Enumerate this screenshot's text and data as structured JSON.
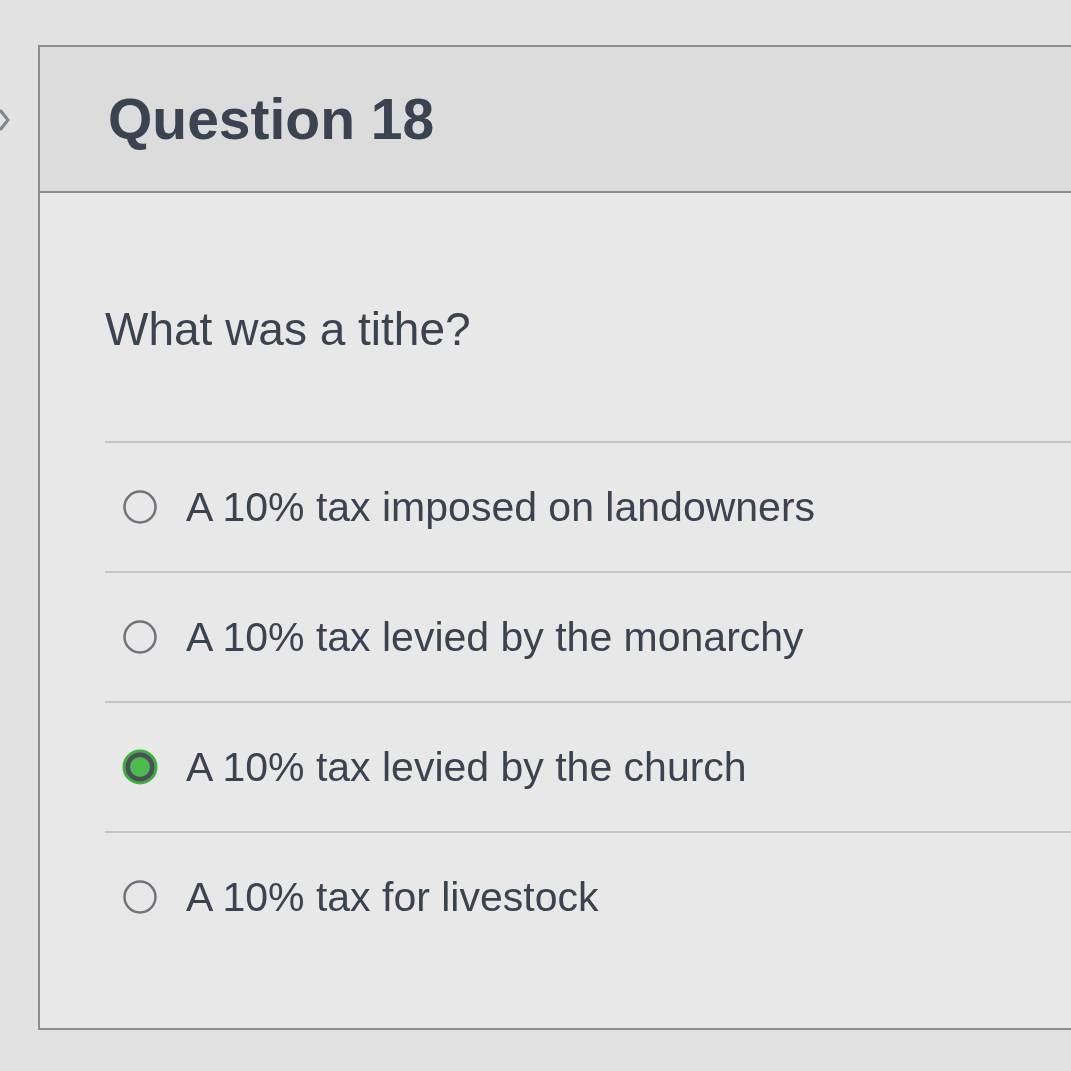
{
  "question": {
    "title": "Question 18",
    "prompt": "What was a tithe?"
  },
  "options": [
    {
      "label": "A 10% tax imposed on landowners",
      "selected": false
    },
    {
      "label": "A 10% tax levied by the monarchy",
      "selected": false
    },
    {
      "label": "A 10% tax levied by the church",
      "selected": true
    },
    {
      "label": "A 10% tax for livestock",
      "selected": false
    }
  ]
}
